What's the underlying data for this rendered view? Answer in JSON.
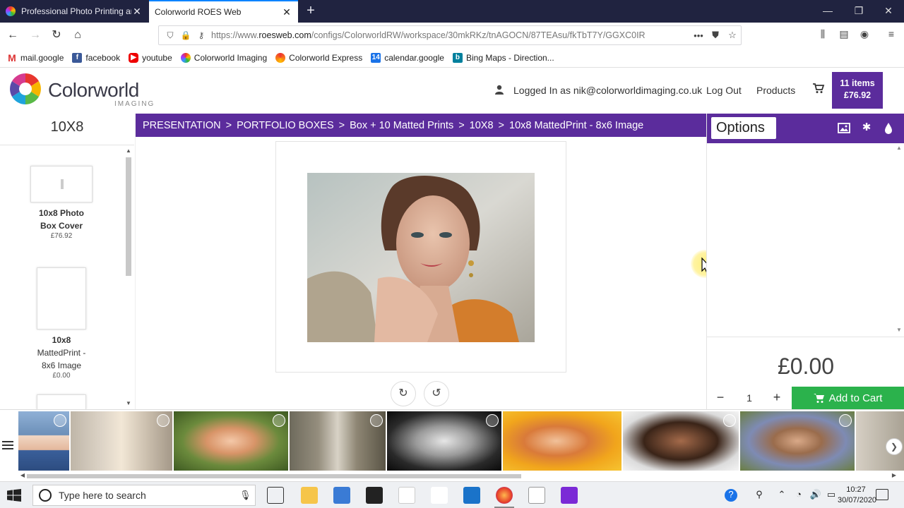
{
  "browser": {
    "tabs": [
      {
        "title": "Professional Photo Printing an",
        "active": false
      },
      {
        "title": "Colorworld ROES Web",
        "active": true
      }
    ],
    "url_prefix": "https://www.",
    "url_domain": "roesweb.com",
    "url_path": "/configs/ColorworldRW/workspace/30mkRKz/tnAGOCN/87TEAsu/fkTbT7Y/GGXC0IR",
    "bookmarks": [
      "mail.google",
      "facebook",
      "youtube",
      "Colorworld Imaging",
      "Colorworld Express",
      "calendar.google",
      "Bing Maps - Direction..."
    ]
  },
  "header": {
    "brand": "Colorworld",
    "brand_sub": "IMAGING",
    "logged_in": "Logged In as nik@colorworldimaging.co.uk",
    "logout": "Log Out",
    "products": "Products",
    "cart_items": "11 items",
    "cart_total": "£76.92"
  },
  "left_panel": {
    "title": "10X8",
    "items": [
      {
        "name_line1": "10x8 Photo",
        "name_line2": "Box Cover",
        "name_line3": "",
        "price": "£76.92"
      },
      {
        "name_line1": "10x8",
        "name_line2": "MattedPrint -",
        "name_line3": "8x6 Image",
        "price": "£0.00"
      }
    ]
  },
  "breadcrumb": [
    "PRESENTATION",
    "PORTFOLIO BOXES",
    "Box + 10 Matted Prints",
    "10X8",
    "10x8 MattedPrint - 8x6 Image"
  ],
  "breadcrumb_separator": ">",
  "options": {
    "title": "Options",
    "price": "£0.00",
    "quantity": "1",
    "add_to_cart": "Add to Cart"
  },
  "taskbar": {
    "search_placeholder": "Type here to search",
    "time": "10:27",
    "date": "30/07/2020"
  },
  "colors": {
    "brand_purple": "#5b2c9c",
    "cart_green": "#2bb24c"
  }
}
